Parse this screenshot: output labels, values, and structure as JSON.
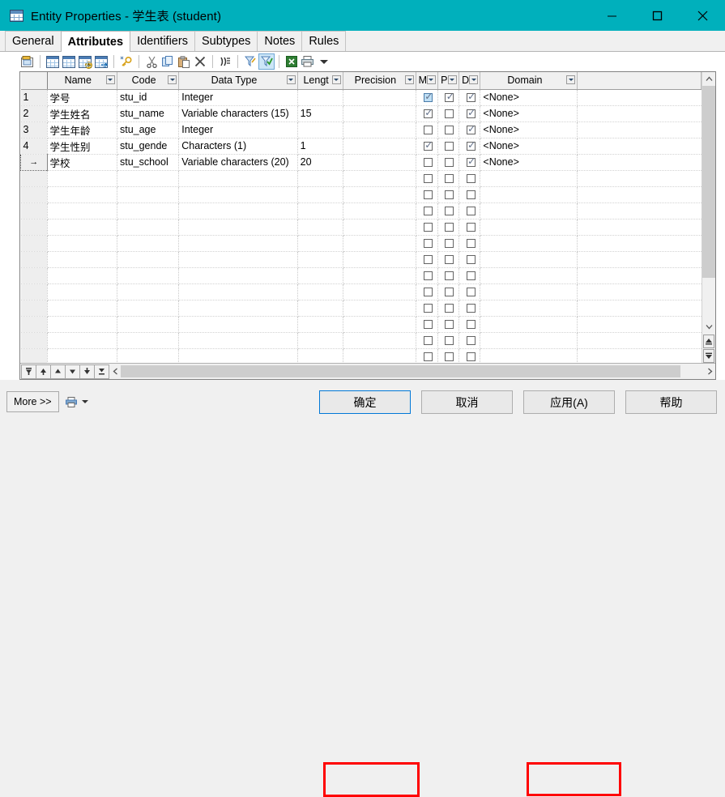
{
  "window": {
    "title": "Entity Properties - 学生表 (student)",
    "icon": "table-icon",
    "controls": [
      {
        "name": "minimize-button",
        "glyph": "minimize"
      },
      {
        "name": "maximize-button",
        "glyph": "maximize"
      },
      {
        "name": "close-button",
        "glyph": "close"
      }
    ],
    "titlebar_color": "#00b0bc"
  },
  "tabs": [
    {
      "label": "General",
      "active": false
    },
    {
      "label": "Attributes",
      "active": true
    },
    {
      "label": "Identifiers",
      "active": false
    },
    {
      "label": "Subtypes",
      "active": false
    },
    {
      "label": "Notes",
      "active": false
    },
    {
      "label": "Rules",
      "active": false
    }
  ],
  "toolbar": {
    "items": [
      {
        "name": "properties-icon",
        "type": "prop"
      },
      {
        "name": "separator",
        "type": "sep"
      },
      {
        "name": "insert-row-icon",
        "type": "grid",
        "badge": "insert"
      },
      {
        "name": "add-row-icon",
        "type": "grid",
        "badge": "add"
      },
      {
        "name": "add-list-icon",
        "type": "grid",
        "badge": "plus"
      },
      {
        "name": "replace-icon",
        "type": "grid",
        "badge": "arrow"
      },
      {
        "name": "separator",
        "type": "sep"
      },
      {
        "name": "primary-key-icon",
        "type": "key"
      },
      {
        "name": "separator",
        "type": "sep"
      },
      {
        "name": "cut-icon",
        "type": "cut"
      },
      {
        "name": "copy-icon",
        "type": "copy"
      },
      {
        "name": "paste-icon",
        "type": "paste"
      },
      {
        "name": "delete-icon",
        "type": "del"
      },
      {
        "name": "separator",
        "type": "sep"
      },
      {
        "name": "find-icon",
        "type": "find"
      },
      {
        "name": "separator",
        "type": "sep"
      },
      {
        "name": "filter-icon",
        "type": "filter"
      },
      {
        "name": "apply-filter-icon",
        "type": "filter2",
        "selected": true
      },
      {
        "name": "separator",
        "type": "sep"
      },
      {
        "name": "excel-export-icon",
        "type": "excel"
      },
      {
        "name": "print-icon",
        "type": "printer"
      },
      {
        "name": "toolbar-overflow-icon",
        "type": "caret"
      }
    ]
  },
  "grid": {
    "columns": [
      {
        "key": "num",
        "label": "",
        "filter": false,
        "width": 32,
        "align": "left"
      },
      {
        "key": "name",
        "label": "Name",
        "filter": true,
        "width": 85,
        "align": "center"
      },
      {
        "key": "code",
        "label": "Code",
        "filter": true,
        "width": 75,
        "align": "center"
      },
      {
        "key": "datatype",
        "label": "Data Type",
        "filter": true,
        "width": 144,
        "align": "center"
      },
      {
        "key": "length",
        "label": "Lengt",
        "filter": true,
        "width": 55,
        "align": "center"
      },
      {
        "key": "precision",
        "label": "Precision",
        "filter": true,
        "width": 89,
        "align": "center"
      },
      {
        "key": "m",
        "label": "M",
        "filter": true,
        "width": 26,
        "align": "center"
      },
      {
        "key": "p",
        "label": "P",
        "filter": true,
        "width": 26,
        "align": "center"
      },
      {
        "key": "d",
        "label": "D",
        "filter": true,
        "width": 26,
        "align": "center"
      },
      {
        "key": "domain",
        "label": "Domain",
        "filter": true,
        "width": 118,
        "align": "center"
      },
      {
        "key": "spare",
        "label": "",
        "filter": false,
        "width": 150,
        "align": "center"
      }
    ],
    "rows": [
      {
        "num": "1",
        "name": "学号",
        "code": "stu_id",
        "datatype": "Integer",
        "length": "",
        "precision": "",
        "m": true,
        "p": true,
        "d": true,
        "m_highlight": true,
        "domain": "<None>",
        "current": false
      },
      {
        "num": "2",
        "name": "学生姓名",
        "code": "stu_name",
        "datatype": "Variable characters (15)",
        "length": "15",
        "precision": "",
        "m": true,
        "p": false,
        "d": true,
        "domain": "<None>",
        "current": false
      },
      {
        "num": "3",
        "name": "学生年龄",
        "code": "stu_age",
        "datatype": "Integer",
        "length": "",
        "precision": "",
        "m": false,
        "p": false,
        "d": true,
        "domain": "<None>",
        "current": false
      },
      {
        "num": "4",
        "name": "学生性别",
        "code": "stu_gende",
        "datatype": "Characters (1)",
        "length": "1",
        "precision": "",
        "m": true,
        "p": false,
        "d": true,
        "domain": "<None>",
        "current": false
      },
      {
        "num": "",
        "name": "学校",
        "code": "stu_school",
        "datatype": "Variable characters (20)",
        "length": "20",
        "precision": "",
        "m": false,
        "p": false,
        "d": true,
        "domain": "<None>",
        "current": true
      }
    ],
    "empty_row_count": 12,
    "row_marker": "→"
  },
  "grid_nav": {
    "buttons": [
      {
        "name": "insert-row-top-button",
        "glyph": "first"
      },
      {
        "name": "move-up-button",
        "glyph": "up"
      },
      {
        "name": "move-top-button",
        "glyph": "uptop"
      },
      {
        "name": "move-down-button",
        "glyph": "down"
      },
      {
        "name": "move-bottom-button",
        "glyph": "downbot"
      },
      {
        "name": "add-row-bottom-button",
        "glyph": "last"
      }
    ]
  },
  "footer": {
    "more_label": "More >>",
    "print_icon": "print-icon",
    "buttons": [
      {
        "name": "ok-button",
        "label": "确定",
        "focused": true,
        "highlight": true
      },
      {
        "name": "cancel-button",
        "label": "取消",
        "focused": false,
        "highlight": false
      },
      {
        "name": "apply-button",
        "label": "应用(A)",
        "focused": false,
        "highlight": true
      },
      {
        "name": "help-button",
        "label": "帮助",
        "focused": false,
        "highlight": false
      }
    ],
    "highlight_color": "#ff0000"
  }
}
